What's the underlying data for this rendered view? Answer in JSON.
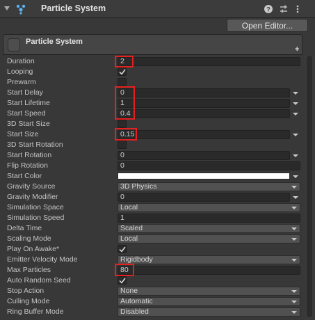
{
  "header": {
    "title": "Particle System",
    "icons": [
      "particle-system-icon",
      "help-icon",
      "presets-icon",
      "more-options-icon"
    ]
  },
  "open_editor_label": "Open Editor...",
  "module": {
    "title": "Particle System",
    "add_label": "+"
  },
  "properties": {
    "duration": {
      "label": "Duration",
      "value": "2"
    },
    "looping": {
      "label": "Looping",
      "checked": true
    },
    "prewarm": {
      "label": "Prewarm",
      "checked": false
    },
    "start_delay": {
      "label": "Start Delay",
      "value": "0"
    },
    "start_lifetime": {
      "label": "Start Lifetime",
      "value": "1"
    },
    "start_speed": {
      "label": "Start Speed",
      "value": "0.4"
    },
    "start_size_3d": {
      "label": "3D Start Size",
      "checked": false
    },
    "start_size": {
      "label": "Start Size",
      "value": "0.15"
    },
    "start_rotation_3d": {
      "label": "3D Start Rotation",
      "checked": false
    },
    "start_rotation": {
      "label": "Start Rotation",
      "value": "0"
    },
    "flip_rotation": {
      "label": "Flip Rotation",
      "value": "0"
    },
    "start_color": {
      "label": "Start Color",
      "color": "#ffffff"
    },
    "gravity_source": {
      "label": "Gravity Source",
      "value": "3D Physics"
    },
    "gravity_modifier": {
      "label": "Gravity Modifier",
      "value": "0"
    },
    "simulation_space": {
      "label": "Simulation Space",
      "value": "Local"
    },
    "simulation_speed": {
      "label": "Simulation Speed",
      "value": "1"
    },
    "delta_time": {
      "label": "Delta Time",
      "value": "Scaled"
    },
    "scaling_mode": {
      "label": "Scaling Mode",
      "value": "Local"
    },
    "play_on_awake": {
      "label": "Play On Awake*",
      "checked": true
    },
    "emitter_velocity_mode": {
      "label": "Emitter Velocity Mode",
      "value": "Rigidbody"
    },
    "max_particles": {
      "label": "Max Particles",
      "value": "80"
    },
    "auto_random_seed": {
      "label": "Auto Random Seed",
      "checked": true
    },
    "stop_action": {
      "label": "Stop Action",
      "value": "None"
    },
    "culling_mode": {
      "label": "Culling Mode",
      "value": "Automatic"
    },
    "ring_buffer_mode": {
      "label": "Ring Buffer Mode",
      "value": "Disabled"
    }
  },
  "highlight_color": "#e52020"
}
